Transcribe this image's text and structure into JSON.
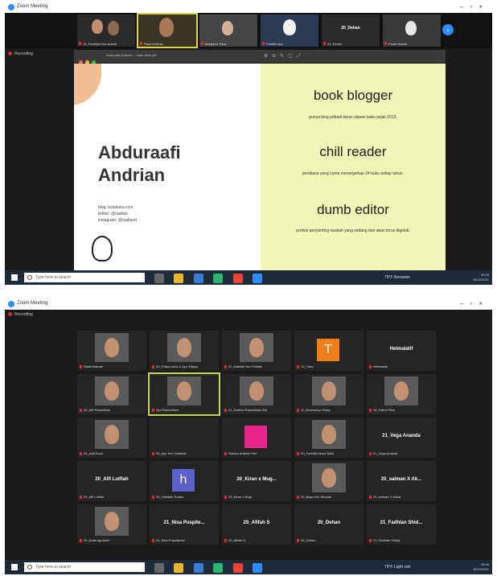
{
  "top": {
    "window_title": "Zoom Meeting",
    "thumbnails": [
      {
        "name": "10_Fadhliya Nur Azizah"
      },
      {
        "name": "Raafi Andrian"
      },
      {
        "name": "Margaret Tiara"
      },
      {
        "name": "Fadilah Ayu"
      },
      {
        "name": "20_Dehan",
        "big": "20_Dehan"
      },
      {
        "name": "Farah Nabila"
      }
    ],
    "recording_label": "Recording",
    "viewer_doc": "Abduraafi Andrian — slide deck.pdf",
    "slide": {
      "name_line1": "Abduraafi",
      "name_line2": "Andrian",
      "contact": [
        "blog: kutubuku.com",
        "twitter: @raafian",
        "instagram: @raafiand"
      ],
      "roles": [
        {
          "title": "book blogger",
          "desc": "punya blog pribadi berisi ulasan buku sejak 2013."
        },
        {
          "title": "chill reader",
          "desc": "pembaca yang cuma menargetkan 24 buku setiap tahun."
        },
        {
          "title": "dumb editor",
          "desc": "profesi penyunting naskah yang sedang dan akan terus digeluti."
        }
      ]
    },
    "taskbar": {
      "search_placeholder": "Type here to search",
      "weather": "79°F  Berawan",
      "time": "15:05",
      "date": "10/10/2021"
    }
  },
  "bottom": {
    "window_title": "Zoom Meeting",
    "recording_label": "Recording",
    "tiles": [
      {
        "name": "Raafi Andrian",
        "kind": "photo"
      },
      {
        "name": "20_Friska Aulia & Ayu Wijaya",
        "kind": "photo"
      },
      {
        "name": "20_Nabilah Nur Fadilah",
        "kind": "photo"
      },
      {
        "name": "13_Tiara",
        "kind": "avatar",
        "letter": "T",
        "color": "#f07c1a"
      },
      {
        "name": "Helmalatif",
        "kind": "text",
        "big": "Helmalatif"
      },
      {
        "name": "20_Afif Ramadhan",
        "kind": "photo"
      },
      {
        "name": "Ayu Ramadhani",
        "kind": "photo",
        "speaker": true
      },
      {
        "name": "21_Rahma Ramadhani Afri",
        "kind": "photo"
      },
      {
        "name": "11_Bramantyo Rizky",
        "kind": "photo"
      },
      {
        "name": "18_Fakhri Fitra",
        "kind": "photo"
      },
      {
        "name": "20_Adit Santi",
        "kind": "photo"
      },
      {
        "name": "20_Ayu Nur Shalihah",
        "kind": "plain"
      },
      {
        "name": "Sandra Ardelia Putri",
        "kind": "avatar",
        "letter": "",
        "color": "#e8258c"
      },
      {
        "name": "20_Fadhilla Nurul Safa",
        "kind": "photo"
      },
      {
        "name": "21_Vega Ananda",
        "kind": "text",
        "big": "21_Vega Ananda"
      },
      {
        "name": "20_Alfi Lutfiah",
        "kind": "text",
        "big": "20_Alfi Lutfiah"
      },
      {
        "name": "20_Habibah Sultan",
        "kind": "avatar",
        "letter": "h",
        "color": "#5960c8"
      },
      {
        "name": "20_Kiran x Mugi",
        "kind": "text",
        "big": "20_Kiran x Mug..."
      },
      {
        "name": "20_Bayu Nur Wiryadi",
        "kind": "photo"
      },
      {
        "name": "20_salman X Akbar",
        "kind": "text",
        "big": "20_salman X Ak..."
      },
      {
        "name": "20_Aulia Agustine",
        "kind": "photo"
      },
      {
        "name": "21_Nisa Puspitarani",
        "kind": "text",
        "big": "21_Nisa Puspite..."
      },
      {
        "name": "20_Afifah S",
        "kind": "text",
        "big": "20_Afifah S"
      },
      {
        "name": "20_Dehan",
        "kind": "text",
        "big": "20_Dehan"
      },
      {
        "name": "21_Fadhlan Shidqi",
        "kind": "text",
        "big": "21_Fadhlan Shid..."
      }
    ],
    "taskbar": {
      "search_placeholder": "Type here to search",
      "weather": "79°F  Light rain",
      "time": "15:06",
      "date": "10/10/2021"
    }
  }
}
